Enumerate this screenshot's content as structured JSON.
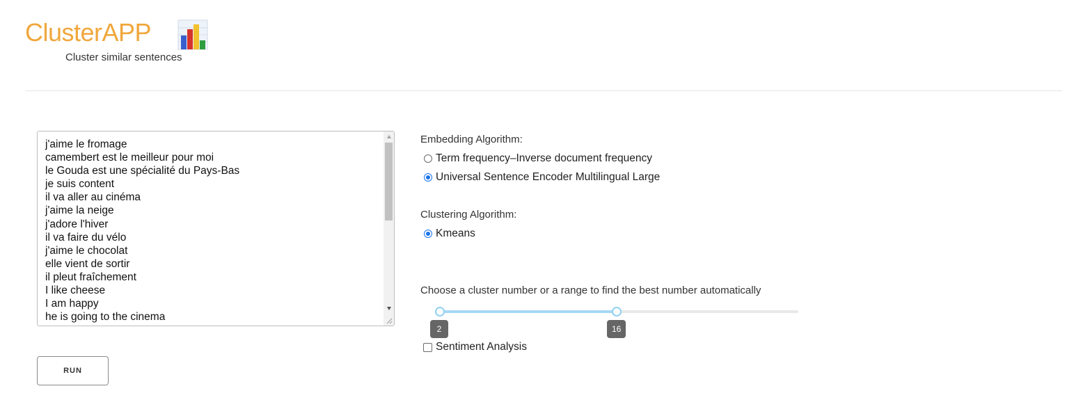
{
  "header": {
    "title": "ClusterAPP",
    "subtitle": "Cluster similar sentences",
    "logo_icon": "bar-chart-icon"
  },
  "input": {
    "lines": [
      "j'aime le fromage",
      "camembert est le meilleur pour moi",
      "le Gouda est une spécialité du Pays-Bas",
      "je suis content",
      "il va aller au cinéma",
      "j'aime la neige",
      "j'adore l'hiver",
      "il va faire du vélo",
      "j'aime le chocolat",
      "elle vient de sortir",
      "il pleut fraîchement",
      "I like cheese",
      "I am happy",
      "he is going to the cinema"
    ]
  },
  "run_label": "RUN",
  "embedding": {
    "label": "Embedding Algorithm:",
    "options": [
      {
        "label": "Term frequency–Inverse document frequency",
        "checked": false
      },
      {
        "label": "Universal Sentence Encoder Multilingual Large",
        "checked": true
      }
    ]
  },
  "clustering": {
    "label": "Clustering Algorithm:",
    "options": [
      {
        "label": "Kmeans",
        "checked": true
      }
    ]
  },
  "cluster_range": {
    "label": "Choose a cluster number or a range to find the best number automatically",
    "min_value": "2",
    "max_value": "16",
    "low_fraction": 0.0,
    "high_fraction": 0.5
  },
  "sentiment": {
    "label": "Sentiment Analysis",
    "checked": false
  },
  "colors": {
    "title": "#f0a73c",
    "radio_accent": "#1a73e8",
    "slider_range": "#a6d8f5",
    "badge_bg": "#666666"
  }
}
